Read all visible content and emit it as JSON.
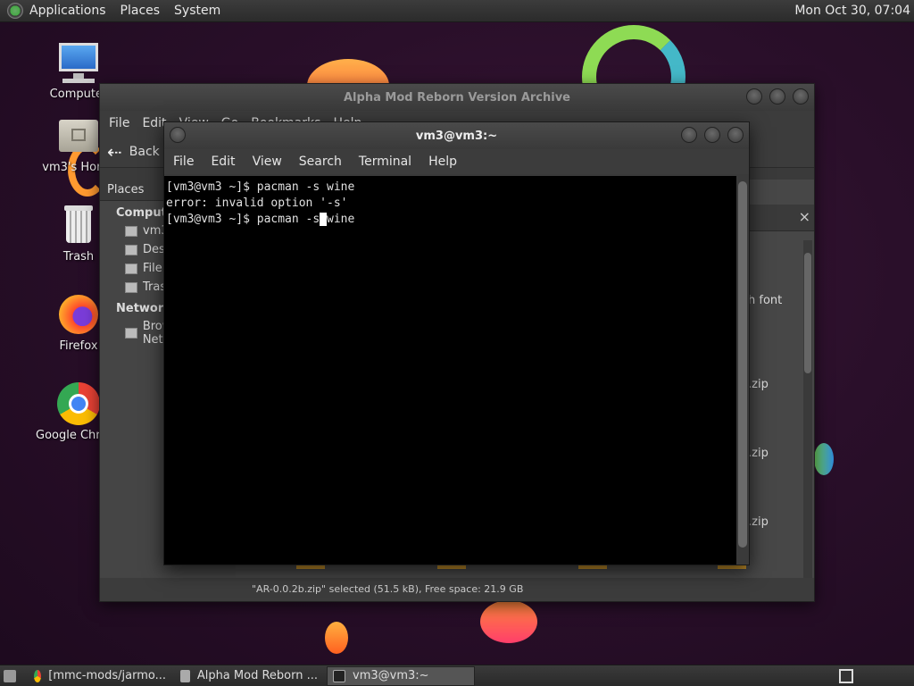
{
  "top_panel": {
    "menus": [
      "Applications",
      "Places",
      "System"
    ],
    "clock": "Mon Oct 30, 07:04"
  },
  "desktop_icons": [
    {
      "label": "Computer",
      "icon": "computer-icon"
    },
    {
      "label": "vm3's Home",
      "icon": "home-folder-icon"
    },
    {
      "label": "Trash",
      "icon": "trash-icon"
    },
    {
      "label": "Firefox",
      "icon": "firefox-icon"
    },
    {
      "label": "Google Chrome",
      "icon": "chrome-icon"
    }
  ],
  "file_manager": {
    "title": "Alpha Mod Reborn Version Archive",
    "menus": [
      "File",
      "Edit",
      "View",
      "Go",
      "Bookmarks",
      "Help"
    ],
    "back_label": "Back",
    "sidebar": {
      "header": "Places",
      "sections": [
        {
          "title": "Computer",
          "items": [
            "vm3",
            "Desktop",
            "File System",
            "Trash"
          ]
        },
        {
          "title": "Network",
          "items": [
            "Browse Network"
          ]
        }
      ]
    },
    "files": [
      "h font",
      ".zip",
      ".zip",
      ".zip"
    ],
    "status": "\"AR-0.0.2b.zip\" selected (51.5 kB), Free space: 21.9 GB"
  },
  "terminal": {
    "title": "vm3@vm3:~",
    "menus": [
      "File",
      "Edit",
      "View",
      "Search",
      "Terminal",
      "Help"
    ],
    "lines": [
      "[vm3@vm3 ~]$ pacman -s wine",
      "error: invalid option '-s'"
    ],
    "current_prompt": "[vm3@vm3 ~]$ pacman -s",
    "cursor_char": " ",
    "current_rest": "wine"
  },
  "taskbar": {
    "tasks": [
      {
        "label": "[mmc-mods/jarmo...",
        "icon": "chrome-icon",
        "active": false
      },
      {
        "label": "Alpha Mod Reborn ...",
        "icon": "folder-icon",
        "active": false
      },
      {
        "label": "vm3@vm3:~",
        "icon": "terminal-icon",
        "active": true
      }
    ]
  },
  "colors": {
    "wallpaper": "#2a0f2a",
    "accent_orange": "#ff8a1e",
    "accent_green": "#7ed957"
  }
}
